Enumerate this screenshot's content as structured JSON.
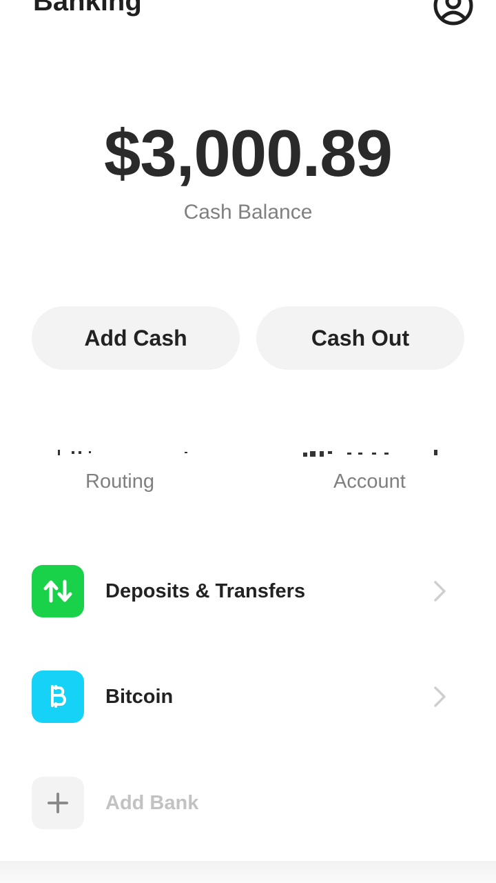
{
  "header": {
    "title": "Banking"
  },
  "balance": {
    "amount": "$3,000.89",
    "label": "Cash Balance"
  },
  "actions": {
    "add_cash": "Add Cash",
    "cash_out": "Cash Out"
  },
  "account_info": {
    "routing_label": "Routing",
    "account_label": "Account"
  },
  "menu": [
    {
      "label": "Deposits & Transfers",
      "icon": "arrows-up-down-icon",
      "color": "#1ad14a"
    },
    {
      "label": "Bitcoin",
      "icon": "bitcoin-icon",
      "color": "#17d2f7"
    },
    {
      "label": "Add Bank",
      "icon": "plus-icon",
      "color": "#f3f3f3"
    }
  ],
  "colors": {
    "accent_green": "#1ad14a",
    "bitcoin_blue": "#17d2f7",
    "muted_text": "#7f7f7f"
  }
}
